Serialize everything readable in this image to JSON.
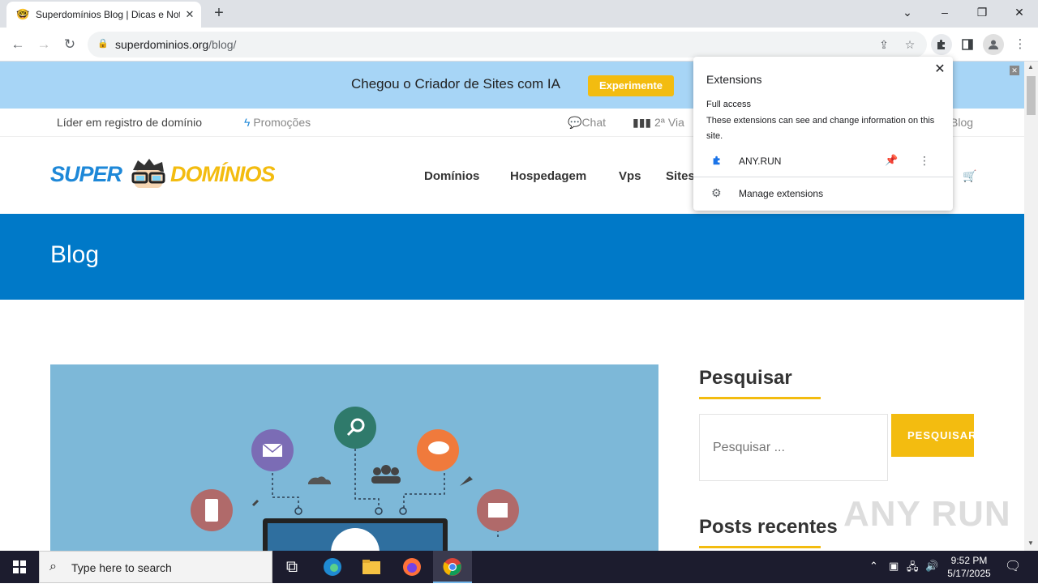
{
  "browser": {
    "tab_title": "Superdomínios Blog | Dicas e Notícias",
    "tab_close": "✕",
    "new_tab": "+",
    "url_host": "superdominios.org",
    "url_path": "/blog/"
  },
  "promo": {
    "text": "Chegou o Criador de Sites com IA",
    "button": "Experimente"
  },
  "topbar": {
    "leader": "Líder em registro de domínio",
    "promotions": "Promoções",
    "chat": "Chat",
    "second_copy": "2ª Via",
    "blog": "Blog"
  },
  "logo": {
    "part1": "SUPER",
    "part2": "DOMÍNIOS"
  },
  "menu": {
    "items": [
      "Domínios",
      "Hospedagem",
      "Vps",
      "Sites"
    ]
  },
  "hero": {
    "title": "Blog"
  },
  "sidebar": {
    "search_title": "Pesquisar",
    "search_placeholder": "Pesquisar ...",
    "search_button": "PESQUISAR",
    "recent_title": "Posts recentes"
  },
  "extensions_popup": {
    "title": "Extensions",
    "full_access": "Full access",
    "description": "These extensions can see and change information on this site.",
    "extension_name": "ANY.RUN",
    "manage": "Manage extensions"
  },
  "watermark": "ANY RUN",
  "taskbar": {
    "search_placeholder": "Type here to search",
    "time": "9:52 PM",
    "date": "5/17/2025"
  },
  "colors": {
    "accent_yellow": "#f3bc10",
    "hero_blue": "#0079c8",
    "promo_bg": "#a7d5f6"
  }
}
